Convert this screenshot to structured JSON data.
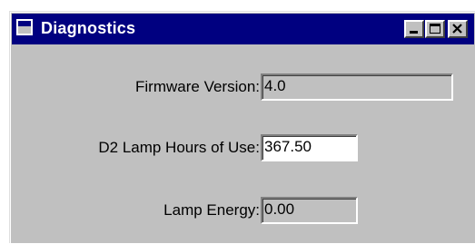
{
  "window": {
    "title": "Diagnostics",
    "icon": "window-icon",
    "controls": {
      "minimize": "minimize-icon",
      "maximize": "maximize-icon",
      "close": "close-icon"
    }
  },
  "fields": {
    "firmware_version": {
      "label": "Firmware Version:",
      "value": "4.0"
    },
    "d2_lamp_hours": {
      "label": "D2 Lamp Hours of Use:",
      "value": "367.50"
    },
    "lamp_energy": {
      "label": "Lamp Energy:",
      "value": "0.00"
    }
  },
  "colors": {
    "titlebar": "#000080",
    "face": "#c0c0c0",
    "title_text": "#ffffff"
  }
}
